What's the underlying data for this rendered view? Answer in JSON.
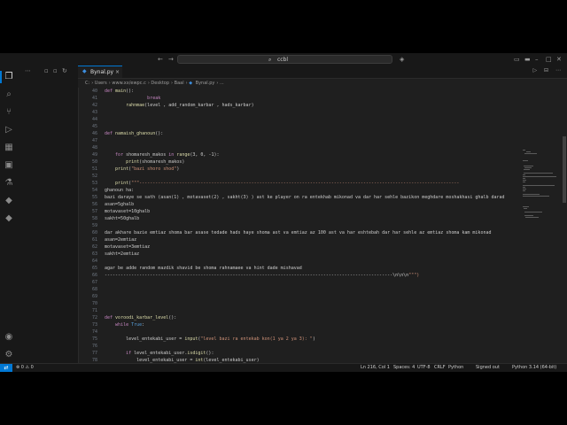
{
  "titlebar": {
    "search_text": "ccbl",
    "nav_back": "←",
    "nav_forward": "→"
  },
  "tab": {
    "name": "Bynal.py",
    "close": "×"
  },
  "breadcrumbs": [
    "C:",
    "Users",
    "www.xx/ewpc.c",
    "Desktop",
    "Baal",
    "Bynal.py",
    "..."
  ],
  "code": [
    {
      "n": "40",
      "t": "def main():"
    },
    {
      "n": "41",
      "t": "                break"
    },
    {
      "n": "42",
      "t": "        rahnmae(level , add_random_karbar , hads_karbar)"
    },
    {
      "n": "43",
      "t": ""
    },
    {
      "n": "44",
      "t": ""
    },
    {
      "n": "45",
      "t": ""
    },
    {
      "n": "46",
      "t": "def namaish_ghanoun():"
    },
    {
      "n": "47",
      "t": ""
    },
    {
      "n": "48",
      "t": ""
    },
    {
      "n": "49",
      "t": "    for shomaresh_makos in range(3, 0, -1):"
    },
    {
      "n": "50",
      "t": "        print(shomaresh_makos)"
    },
    {
      "n": "51",
      "t": "    print(\"bazi shoro shod\")"
    },
    {
      "n": "52",
      "t": ""
    },
    {
      "n": "53",
      "t": "    print(\"\"\"------------------------------------------------------------------------------------------------------------------------"
    },
    {
      "n": "54",
      "t": "ghanoun ha:"
    },
    {
      "n": "55",
      "t": "bazi daraye se sath (asan(1) , motavaset(2) , sakht(3) ) ast ke player on ra entekhab mikonad va dar har sehle bazikon meghdare moshakhasi ghalb darad"
    },
    {
      "n": "56",
      "t": "asan=5ghalb"
    },
    {
      "n": "57",
      "t": "motavaset=10ghalb"
    },
    {
      "n": "58",
      "t": "sakht=50ghalb"
    },
    {
      "n": "59",
      "t": ""
    },
    {
      "n": "60",
      "t": "dar akhare bazie emtiaz shoma bar asase tedade hads haye shoma ast va emtiaz az 100 ast va har eshtebah dar har sehle az emtiaz shoma kam mikonad"
    },
    {
      "n": "61",
      "t": "asan=2emtiaz"
    },
    {
      "n": "62",
      "t": "motavaset=3emtiaz"
    },
    {
      "n": "63",
      "t": "sakht=2emtiaz"
    },
    {
      "n": "64",
      "t": ""
    },
    {
      "n": "65",
      "t": "agar be adde random mazdik shavid be shoma rahnamaee va hint dade mishavad"
    },
    {
      "n": "66",
      "t": "------------------------------------------------------------------------------------------------------------\\n\\n\\n\"\"\")"
    },
    {
      "n": "67",
      "t": ""
    },
    {
      "n": "68",
      "t": ""
    },
    {
      "n": "69",
      "t": ""
    },
    {
      "n": "70",
      "t": ""
    },
    {
      "n": "71",
      "t": ""
    },
    {
      "n": "72",
      "t": "def voroodi_karbar_level():"
    },
    {
      "n": "73",
      "t": "    while True:"
    },
    {
      "n": "74",
      "t": ""
    },
    {
      "n": "75",
      "t": "        level_entekabi_user = input(\"level bazi ra entekab kon(1 ya 2 ya 3): \")"
    },
    {
      "n": "76",
      "t": ""
    },
    {
      "n": "77",
      "t": "        if level_entekabi_user.isdigit():"
    },
    {
      "n": "78",
      "t": "            level_entekabi_user = int(level_entekabi_user)"
    }
  ],
  "status": {
    "errors": "⊗ 0  ⚠ 0",
    "position": "Ln 216, Col 1",
    "spaces": "Spaces: 4",
    "encoding": "UTF-8",
    "eol": "CRLF",
    "language": "Python",
    "signed": "Signed out",
    "interpreter": "Python 3.14 (64-bit)"
  },
  "colors": {
    "accent": "#0078d4",
    "editor_bg": "#1f1f1f",
    "chrome_bg": "#181818"
  }
}
